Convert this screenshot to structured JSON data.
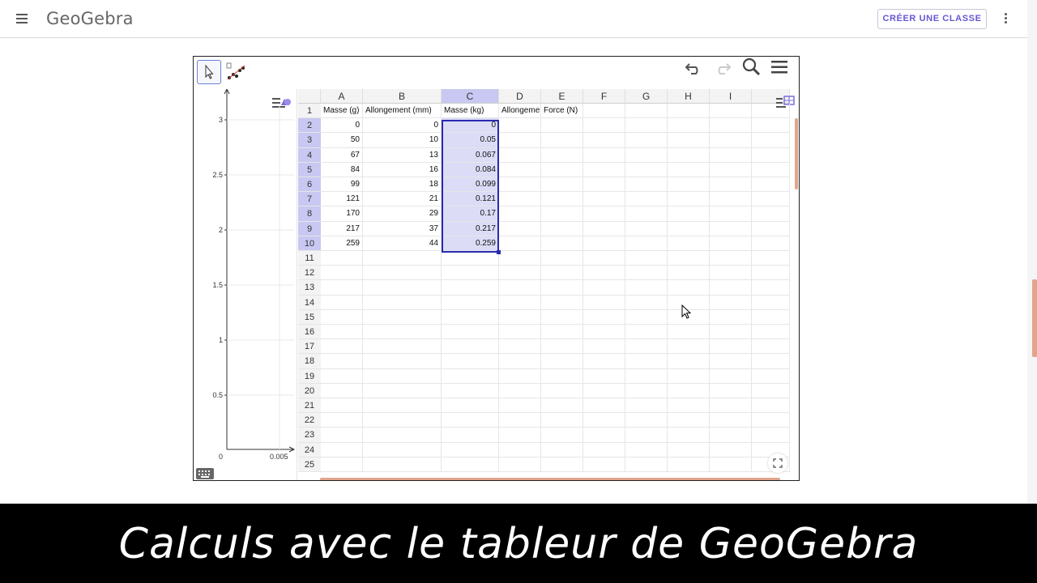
{
  "header": {
    "logo": "GeoGebra",
    "create_class_label": "CRÉER UNE CLASSE"
  },
  "graphics": {
    "y_ticks": [
      "3",
      "2.5",
      "2",
      "1.5",
      "1",
      "0.5"
    ],
    "x_ticks": [
      "0",
      "0.005"
    ]
  },
  "spreadsheet": {
    "columns": [
      "A",
      "B",
      "C",
      "D",
      "E",
      "F",
      "G",
      "H",
      "I"
    ],
    "rows": [
      "1",
      "2",
      "3",
      "4",
      "5",
      "6",
      "7",
      "8",
      "9",
      "10",
      "11",
      "12",
      "13",
      "14",
      "15",
      "16",
      "17",
      "18",
      "19",
      "20",
      "21",
      "22",
      "23",
      "24",
      "25"
    ],
    "headers": {
      "A": "Masse (g)",
      "B": "Allongement (mm)",
      "C": "Masse (kg)",
      "D": "Allongeme",
      "E": "Force (N)"
    },
    "data": [
      {
        "a": "0",
        "b": "0",
        "c": "0"
      },
      {
        "a": "50",
        "b": "10",
        "c": "0.05"
      },
      {
        "a": "67",
        "b": "13",
        "c": "0.067"
      },
      {
        "a": "84",
        "b": "16",
        "c": "0.084"
      },
      {
        "a": "99",
        "b": "18",
        "c": "0.099"
      },
      {
        "a": "121",
        "b": "21",
        "c": "0.121"
      },
      {
        "a": "170",
        "b": "29",
        "c": "0.17"
      },
      {
        "a": "217",
        "b": "37",
        "c": "0.217"
      },
      {
        "a": "259",
        "b": "44",
        "c": "0.259"
      }
    ],
    "selected_column": "C"
  },
  "caption": "Calculs avec le tableur de GeoGebra",
  "colors": {
    "accent": "#6557d2",
    "selection": "#2a2ab0",
    "scrollbar": "#e0a58c"
  }
}
